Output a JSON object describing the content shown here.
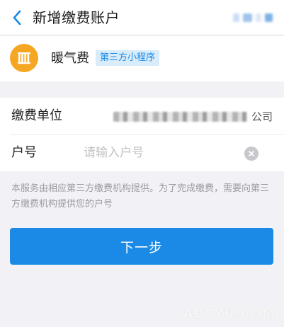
{
  "header": {
    "title": "新增缴费账户"
  },
  "service": {
    "icon": "radiator-icon",
    "name": "暖气费",
    "badge": "第三方小程序"
  },
  "form": {
    "unit_label": "缴费单位",
    "unit_value_tail": "公司",
    "account_label": "户号",
    "account_placeholder": "请输入户号",
    "account_value": ""
  },
  "notice": "本服务由相应第三方缴费机构提供。为了完成缴费，需要向第三方缴费机构提供您的户号",
  "actions": {
    "next_label": "下一步"
  },
  "watermark": "APPYU.COM",
  "colors": {
    "accent": "#1a8ae6",
    "icon_bg": "#f5a623",
    "badge_bg": "#d8ecfb",
    "background": "#f2f2f6"
  }
}
